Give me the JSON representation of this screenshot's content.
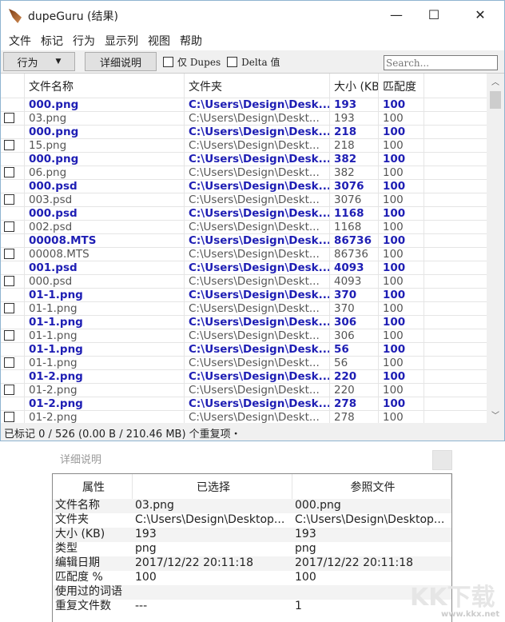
{
  "window": {
    "title": "dupeGuru (结果)",
    "minimize": "—",
    "maximize": "☐",
    "close": "✕"
  },
  "menu": [
    "文件",
    "标记",
    "行为",
    "显示列",
    "视图",
    "帮助"
  ],
  "toolbar": {
    "actions": "行为",
    "details": "详细说明",
    "dupes_only": "仅 Dupes",
    "delta": "Delta 值",
    "search_placeholder": "Search..."
  },
  "columns": [
    "文件名称",
    "文件夹",
    "大小 (KB)",
    "匹配度"
  ],
  "rows": [
    {
      "ref": true,
      "name": "000.png",
      "folder": "C:\\Users\\Design\\Desk...",
      "size": "193",
      "match": "100"
    },
    {
      "ref": false,
      "name": "03.png",
      "folder": "C:\\Users\\Design\\Deskt...",
      "size": "193",
      "match": "100"
    },
    {
      "ref": true,
      "name": "000.png",
      "folder": "C:\\Users\\Design\\Desk...",
      "size": "218",
      "match": "100"
    },
    {
      "ref": false,
      "name": "15.png",
      "folder": "C:\\Users\\Design\\Deskt...",
      "size": "218",
      "match": "100"
    },
    {
      "ref": true,
      "name": "000.png",
      "folder": "C:\\Users\\Design\\Desk...",
      "size": "382",
      "match": "100"
    },
    {
      "ref": false,
      "name": "06.png",
      "folder": "C:\\Users\\Design\\Deskt...",
      "size": "382",
      "match": "100"
    },
    {
      "ref": true,
      "name": "000.psd",
      "folder": "C:\\Users\\Design\\Desk...",
      "size": "3076",
      "match": "100"
    },
    {
      "ref": false,
      "name": "003.psd",
      "folder": "C:\\Users\\Design\\Deskt...",
      "size": "3076",
      "match": "100"
    },
    {
      "ref": true,
      "name": "000.psd",
      "folder": "C:\\Users\\Design\\Desk...",
      "size": "1168",
      "match": "100"
    },
    {
      "ref": false,
      "name": "002.psd",
      "folder": "C:\\Users\\Design\\Deskt...",
      "size": "1168",
      "match": "100"
    },
    {
      "ref": true,
      "name": "00008.MTS",
      "folder": "C:\\Users\\Design\\Desk...",
      "size": "86736",
      "match": "100"
    },
    {
      "ref": false,
      "name": "00008.MTS",
      "folder": "C:\\Users\\Design\\Deskt...",
      "size": "86736",
      "match": "100"
    },
    {
      "ref": true,
      "name": "001.psd",
      "folder": "C:\\Users\\Design\\Desk...",
      "size": "4093",
      "match": "100"
    },
    {
      "ref": false,
      "name": "000.psd",
      "folder": "C:\\Users\\Design\\Deskt...",
      "size": "4093",
      "match": "100"
    },
    {
      "ref": true,
      "name": "01-1.png",
      "folder": "C:\\Users\\Design\\Desk...",
      "size": "370",
      "match": "100"
    },
    {
      "ref": false,
      "name": "01-1.png",
      "folder": "C:\\Users\\Design\\Deskt...",
      "size": "370",
      "match": "100"
    },
    {
      "ref": true,
      "name": "01-1.png",
      "folder": "C:\\Users\\Design\\Desk...",
      "size": "306",
      "match": "100"
    },
    {
      "ref": false,
      "name": "01-1.png",
      "folder": "C:\\Users\\Design\\Deskt...",
      "size": "306",
      "match": "100"
    },
    {
      "ref": true,
      "name": "01-1.png",
      "folder": "C:\\Users\\Design\\Desk...",
      "size": "56",
      "match": "100"
    },
    {
      "ref": false,
      "name": "01-1.png",
      "folder": "C:\\Users\\Design\\Deskt...",
      "size": "56",
      "match": "100"
    },
    {
      "ref": true,
      "name": "01-2.png",
      "folder": "C:\\Users\\Design\\Desk...",
      "size": "220",
      "match": "100"
    },
    {
      "ref": false,
      "name": "01-2.png",
      "folder": "C:\\Users\\Design\\Deskt...",
      "size": "220",
      "match": "100"
    },
    {
      "ref": true,
      "name": "01-2.png",
      "folder": "C:\\Users\\Design\\Desk...",
      "size": "278",
      "match": "100"
    },
    {
      "ref": false,
      "name": "01-2.png",
      "folder": "C:\\Users\\Design\\Deskt...",
      "size": "278",
      "match": "100"
    }
  ],
  "status": "已标记 0 / 526 (0.00 B / 210.46 MB) 个重复项・",
  "details": {
    "title": "详细说明",
    "headers": [
      "属性",
      "已选择",
      "参照文件"
    ],
    "rows": [
      [
        "文件名称",
        "03.png",
        "000.png"
      ],
      [
        "文件夹",
        "C:\\Users\\Design\\Desktop...",
        "C:\\Users\\Design\\Desktop..."
      ],
      [
        "大小 (KB)",
        "193",
        "193"
      ],
      [
        "类型",
        "png",
        "png"
      ],
      [
        "编辑日期",
        "2017/12/22 20:11:18",
        "2017/12/22 20:11:18"
      ],
      [
        "匹配度 %",
        "100",
        "100"
      ],
      [
        "使用过的词语",
        "",
        ""
      ],
      [
        "重复文件数",
        "---",
        "1"
      ]
    ]
  },
  "watermark": {
    "logo": "KK下载",
    "url": "www.kkx.net"
  }
}
